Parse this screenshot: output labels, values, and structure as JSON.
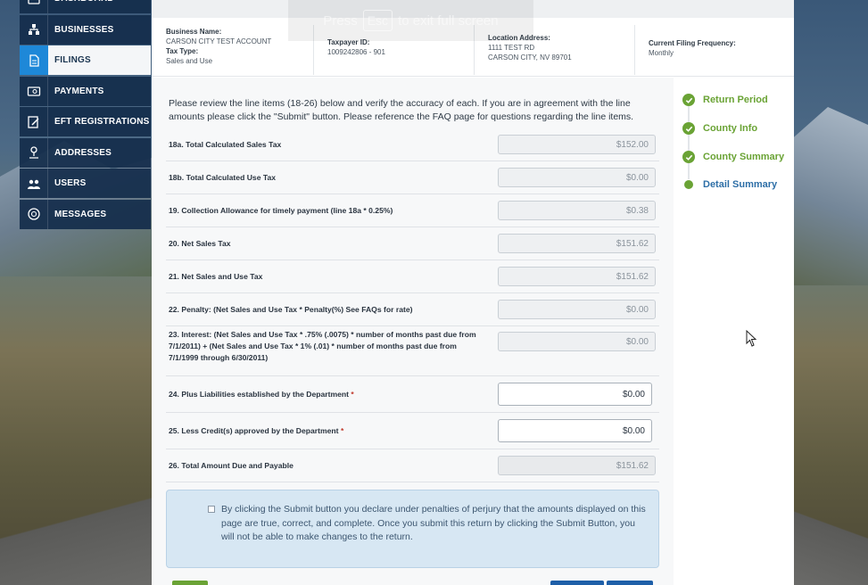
{
  "fullscreen_notice": {
    "before": "Press",
    "key": "Esc",
    "after": "to exit full screen"
  },
  "sidebar": {
    "items": [
      {
        "label": "DASHBOARD",
        "icon": "dashboard-icon",
        "active": false
      },
      {
        "label": "BUSINESSES",
        "icon": "businesses-icon",
        "active": false
      },
      {
        "label": "FILINGS",
        "icon": "filings-icon",
        "active": true
      },
      {
        "label": "PAYMENTS",
        "icon": "payments-icon",
        "active": false
      },
      {
        "label": "EFT REGISTRATIONS",
        "icon": "eft-icon",
        "active": false
      },
      {
        "label": "ADDRESSES",
        "icon": "addresses-icon",
        "active": false
      },
      {
        "label": "USERS",
        "icon": "users-icon",
        "active": false
      },
      {
        "label": "MESSAGES",
        "icon": "messages-icon",
        "active": false
      }
    ]
  },
  "header": {
    "business_name_label": "Business Name:",
    "business_name": "CARSON CITY TEST ACCOUNT",
    "tax_type_label": "Tax Type:",
    "tax_type": "Sales and Use",
    "taxpayer_id_label": "Taxpayer ID:",
    "taxpayer_id": "1009242806 - 901",
    "location_label": "Location Address:",
    "location_line1": "1111 TEST RD",
    "location_line2": "CARSON CITY, NV 89701",
    "frequency_label": "Current Filing Frequency:",
    "frequency": "Monthly"
  },
  "intro_text": "Please review the line items (18-26) below and verify the accuracy of each. If you are in agreement with the line amounts please click the \"Submit\" button. Please reference the FAQ page for questions regarding the line items.",
  "line_items": [
    {
      "label": "18a. Total Calculated Sales Tax",
      "value": "$152.00",
      "editable": false,
      "required": false
    },
    {
      "label": "18b. Total Calculated Use Tax",
      "value": "$0.00",
      "editable": false,
      "required": false
    },
    {
      "label": "19. Collection Allowance for timely payment (line 18a * 0.25%)",
      "value": "$0.38",
      "editable": false,
      "required": false
    },
    {
      "label": "20. Net Sales Tax",
      "value": "$151.62",
      "editable": false,
      "required": false
    },
    {
      "label": "21. Net Sales and Use Tax",
      "value": "$151.62",
      "editable": false,
      "required": false
    },
    {
      "label": "22. Penalty: (Net Sales and Use Tax * Penalty(%) See FAQs for rate)",
      "value": "$0.00",
      "editable": false,
      "required": false
    },
    {
      "label": "23. Interest: (Net Sales and Use Tax * .75% (.0075) * number of months past due from 7/1/2011) + (Net Sales and Use Tax * 1% (.01) * number of months past due from 7/1/1999 through 6/30/2011)",
      "value": "$0.00",
      "editable": false,
      "required": false
    },
    {
      "label": "24. Plus Liabilities established by the Department",
      "value": "$0.00",
      "editable": true,
      "required": true
    },
    {
      "label": "25. Less Credit(s) approved by the Department",
      "value": "$0.00",
      "editable": true,
      "required": true
    },
    {
      "label": "26. Total Amount Due and Payable",
      "value": "$151.62",
      "editable": false,
      "required": false
    }
  ],
  "required_marker": "*",
  "declaration_text": "By clicking the Submit button you declare under penalties of perjury that the amounts displayed on this page are true, correct, and complete. Once you submit this return by clicking the Submit Button, you will not be able to make changes to the return.",
  "steps": [
    {
      "label": "Return Period",
      "state": "complete"
    },
    {
      "label": "County Info",
      "state": "complete"
    },
    {
      "label": "County Summary",
      "state": "complete"
    },
    {
      "label": "Detail Summary",
      "state": "current"
    }
  ],
  "colors": {
    "accent_blue": "#1e88d8",
    "sidebar_bg": "#142d4b",
    "step_green": "#6aa335",
    "step_current": "#2e6fa7"
  }
}
